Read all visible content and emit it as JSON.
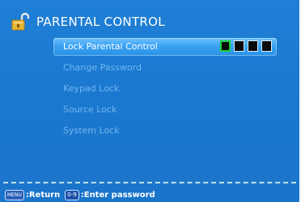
{
  "title": "PARENTAL CONTROL",
  "menu": {
    "items": [
      {
        "label": "Lock Parental Control"
      },
      {
        "label": "Change Password"
      },
      {
        "label": "Keypad Lock"
      },
      {
        "label": "Source Lock"
      },
      {
        "label": "System Lock"
      }
    ]
  },
  "password": {
    "digits": [
      "",
      "",
      "",
      ""
    ]
  },
  "footer": {
    "menu_key": "MENU",
    "return_label": ":Return",
    "num_key": "0-9",
    "enter_label": ":Enter password"
  },
  "colors": {
    "background": "#1c79d0",
    "selected_bg": "#3aa2f2",
    "disabled_text": "#6fb6f0",
    "cursor_border": "#19d23a"
  },
  "icons": {
    "header": "padlock-open-icon"
  }
}
